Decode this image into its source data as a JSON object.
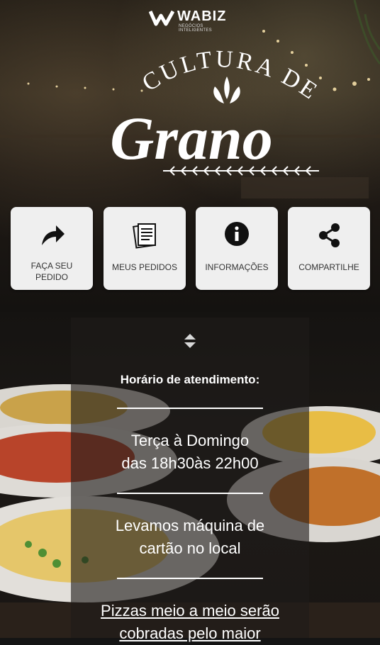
{
  "brand": {
    "name": "WABIZ",
    "tagline": "NEGÓCIOS INTELIGENTES"
  },
  "restaurant": {
    "title_top": "CULTURA DEL",
    "title_script": "Grano"
  },
  "tiles": [
    {
      "label_line1": "FAÇA SEU",
      "label_line2": "PEDIDO",
      "icon": "share-arrow-icon"
    },
    {
      "label_line1": "MEUS PEDIDOS",
      "icon": "receipt-icon"
    },
    {
      "label_line1": "INFORMAÇÕES",
      "icon": "info-icon"
    },
    {
      "label_line1": "COMPARTILHE",
      "icon": "share-icon"
    }
  ],
  "info": {
    "hours_title": "Horário de atendimento:",
    "days": "Terça  à Domingo",
    "times": "das 18h30às 22h00",
    "card_line1": "Levamos máquina de",
    "card_line2": "cartão no local",
    "pizza_line1": "Pizzas meio a meio serão",
    "pizza_line2": "cobradas pelo maior"
  },
  "colors": {
    "tile_bg": "#efefef",
    "tile_text": "#333333",
    "panel_bg": "rgba(30,28,26,0.62)"
  }
}
